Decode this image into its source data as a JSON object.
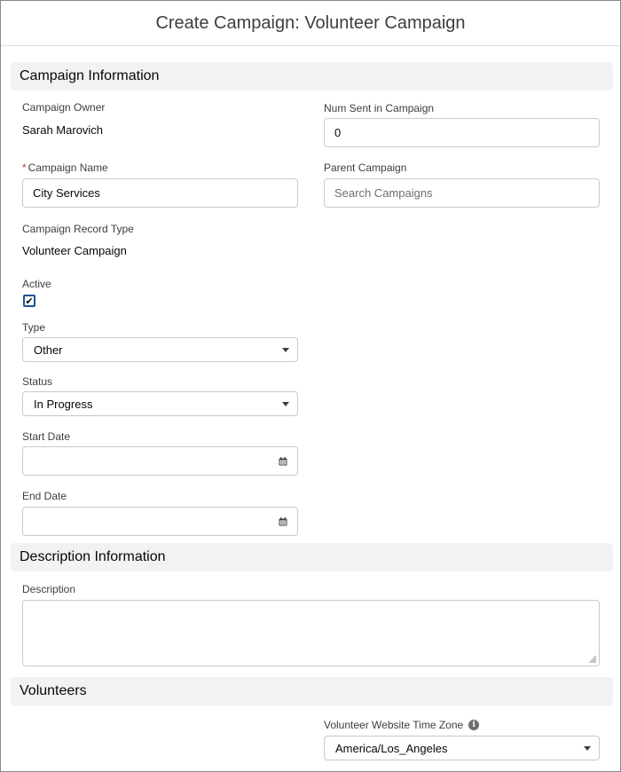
{
  "modal": {
    "title": "Create Campaign: Volunteer Campaign"
  },
  "sections": {
    "campaign_information": "Campaign Information",
    "description_information": "Description Information",
    "volunteers": "Volunteers"
  },
  "fields": {
    "campaign_owner": {
      "label": "Campaign Owner",
      "value": "Sarah Marovich"
    },
    "num_sent": {
      "label": "Num Sent in Campaign",
      "value": "0"
    },
    "campaign_name": {
      "required_mark": "*",
      "label": "Campaign Name",
      "value": "City Services"
    },
    "parent_campaign": {
      "label": "Parent Campaign",
      "placeholder": "Search Campaigns"
    },
    "record_type": {
      "label": "Campaign Record Type",
      "value": "Volunteer Campaign"
    },
    "active": {
      "label": "Active",
      "checked": true,
      "check_glyph": "✔"
    },
    "type": {
      "label": "Type",
      "value": "Other"
    },
    "status": {
      "label": "Status",
      "value": "In Progress"
    },
    "start_date": {
      "label": "Start Date",
      "value": ""
    },
    "end_date": {
      "label": "End Date",
      "value": ""
    },
    "description": {
      "label": "Description",
      "value": ""
    },
    "timezone": {
      "label": "Volunteer Website Time Zone",
      "info_glyph": "i",
      "value": "America/Los_Angeles"
    }
  },
  "icons": {
    "calendar": "calendar-icon",
    "dropdown": "chevron-down-icon",
    "info": "info-icon",
    "resize": "resize-handle-icon"
  },
  "colors": {
    "section_bg": "#f3f2f2",
    "border": "#c9c9c9",
    "required": "#c23934",
    "label": "#3e3e3c",
    "checkbox_border": "#1b5297"
  }
}
